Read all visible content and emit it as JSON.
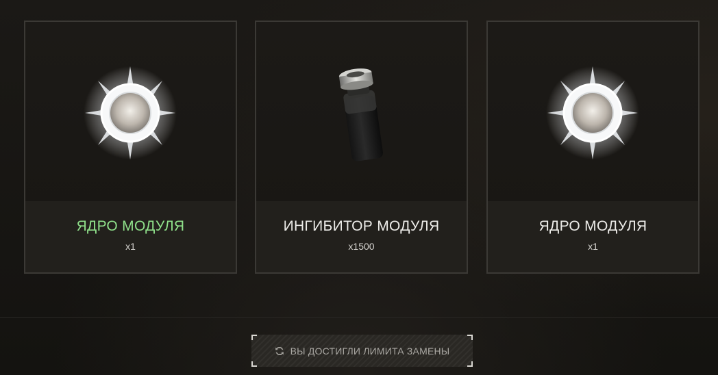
{
  "cards": [
    {
      "title": "ЯДРО МОДУЛЯ",
      "quantity": "x1",
      "title_color": "#8fe08a",
      "icon": "module-core-icon"
    },
    {
      "title": "ИНГИБИТОР МОДУЛЯ",
      "quantity": "x1500",
      "title_color": "#ecebe8",
      "icon": "module-inhibitor-vial-icon"
    },
    {
      "title": "ЯДРО МОДУЛЯ",
      "quantity": "x1",
      "title_color": "#ecebe8",
      "icon": "module-core-icon"
    }
  ],
  "replace_button": {
    "label": "ВЫ ДОСТИГЛИ ЛИМИТА ЗАМЕНЫ",
    "icon": "refresh-icon",
    "disabled": true
  }
}
